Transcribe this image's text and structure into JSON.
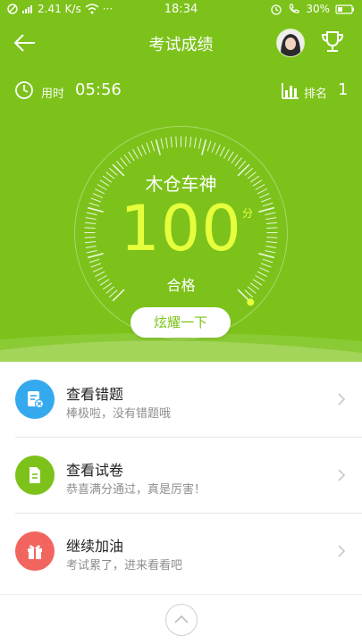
{
  "status_bar": {
    "network_speed": "2.41 K/s",
    "time": "18:34",
    "battery": "30%",
    "icons": [
      "no-sim-icon",
      "signal-icon",
      "wifi-icon",
      "more-icon",
      "alarm-icon",
      "call-icon",
      "battery-icon"
    ]
  },
  "header": {
    "title": "考试成绩",
    "back_icon": "back-arrow-icon",
    "trophy_icon": "trophy-icon"
  },
  "stats": {
    "time_label": "用时",
    "time_value": "05:56",
    "rank_label": "排名",
    "rank_value": "1"
  },
  "result": {
    "user_name": "木仓车神",
    "score": "100",
    "score_unit": "分",
    "status": "合格",
    "score_progress": 1.0
  },
  "share_button": "炫耀一下",
  "actions": [
    {
      "title": "查看错题",
      "subtitle": "棒极啦，没有错题哦",
      "icon": "wrong-questions-icon",
      "color": "#35a9ee"
    },
    {
      "title": "查看试卷",
      "subtitle": "恭喜满分通过，真是厉害！",
      "icon": "paper-icon",
      "color": "#7cc21a"
    },
    {
      "title": "继续加油",
      "subtitle": "考试累了，进来看看吧",
      "icon": "gift-icon",
      "color": "#f2655f"
    }
  ],
  "colors": {
    "primary": "#7cc21a",
    "score": "#e6ff3c",
    "blue": "#35a9ee",
    "red": "#f2655f"
  }
}
